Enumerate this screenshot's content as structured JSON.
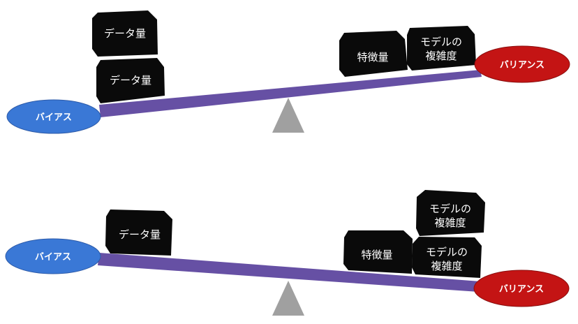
{
  "labels": {
    "bias": "バイアス",
    "variance": "バリアンス",
    "data_amount": "データ量",
    "features": "特徴量",
    "model_complexity_line1": "モデルの",
    "model_complexity_line2": "複雑度"
  },
  "colors": {
    "beam": "#6650a4",
    "fulcrum": "#a0a0a0",
    "bias_ellipse": "#3a78d6",
    "variance_ellipse": "#c41414",
    "weight_block": "#0a0a0a"
  }
}
